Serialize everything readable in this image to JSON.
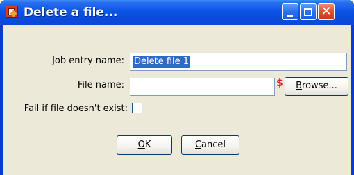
{
  "window": {
    "title": "Delete a file...",
    "icon": "app-icon"
  },
  "form": {
    "job_entry_label": "Job entry name:",
    "job_entry_value": "Delete file 1",
    "file_name_label": "File name:",
    "file_name_value": "",
    "variable_marker": "$",
    "browse_button": {
      "pre": "",
      "accel": "B",
      "post": "rowse..."
    },
    "fail_label": "Fail if file doesn't exist:",
    "fail_checked": false
  },
  "buttons": {
    "ok": {
      "accel": "O",
      "post": "K"
    },
    "cancel": {
      "accel": "C",
      "post": "ancel"
    }
  },
  "colors": {
    "titlebar": "#0b55e6",
    "client": "#ece9d8",
    "selection": "#316ac5"
  }
}
